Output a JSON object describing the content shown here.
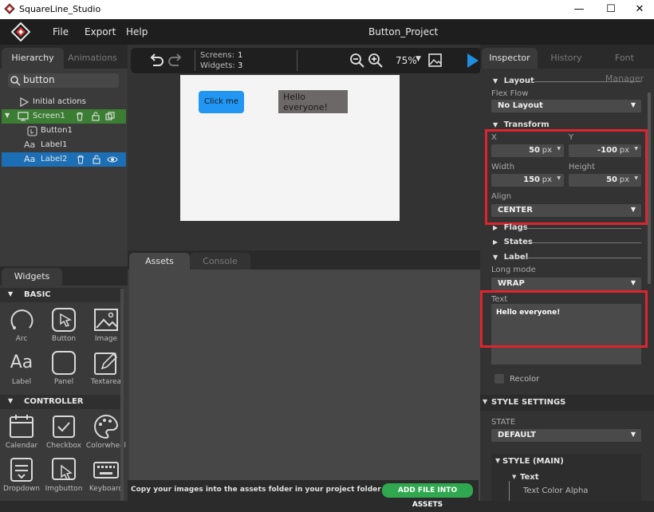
{
  "window": {
    "title": "SquareLine_Studio"
  },
  "menu": {
    "items": [
      "File",
      "Export",
      "Help"
    ],
    "project": "Button_Project"
  },
  "hierarchy": {
    "tabs": [
      "Hierarchy",
      "Animations"
    ],
    "search": "button",
    "tree": [
      {
        "label": "Initial actions"
      },
      {
        "label": "Screen1"
      },
      {
        "label": "Button1"
      },
      {
        "label": "Label1"
      },
      {
        "label": "Label2"
      }
    ]
  },
  "widgets": {
    "tab": "Widgets",
    "basic": {
      "title": "BASIC",
      "items": [
        "Arc",
        "Button",
        "Image",
        "Label",
        "Panel",
        "Textarea"
      ]
    },
    "controller": {
      "title": "CONTROLLER",
      "items": [
        "Calendar",
        "Checkbox",
        "Colorwheel",
        "Dropdown",
        "Imgbutton",
        "Keyboard"
      ]
    }
  },
  "toolbar": {
    "screens_label": "Screens:",
    "screens_value": "1",
    "widgets_label": "Widgets:",
    "widgets_value": "3",
    "zoom": "75%"
  },
  "canvas": {
    "button_text": "Click me",
    "label_text": "Hello everyone!"
  },
  "assets": {
    "tabs": [
      "Assets",
      "Console"
    ],
    "footer_text": "Copy your images into the assets folder in your project folder",
    "add_button": "ADD FILE INTO ASSETS"
  },
  "inspector": {
    "tabs": [
      "Inspector",
      "History",
      "Font Manager"
    ],
    "layout": {
      "title": "Layout",
      "flex_label": "Flex Flow",
      "flex_value": "No Layout"
    },
    "transform": {
      "title": "Transform",
      "x_label": "X",
      "x_value": "50",
      "x_unit": "px",
      "y_label": "Y",
      "y_value": "-100",
      "y_unit": "px",
      "w_label": "Width",
      "w_value": "150",
      "w_unit": "px",
      "h_label": "Height",
      "h_value": "50",
      "h_unit": "px",
      "align_label": "Align",
      "align_value": "CENTER"
    },
    "flags": "Flags",
    "states": "States",
    "label": {
      "title": "Label",
      "long_mode_label": "Long mode",
      "long_mode_value": "WRAP",
      "text_label": "Text",
      "text_value": "Hello everyone!",
      "recolor": "Recolor"
    },
    "style_settings": "STYLE SETTINGS",
    "state_label": "STATE",
    "state_value": "DEFAULT",
    "style_main": "STYLE (MAIN)",
    "text_section": "Text",
    "text_color_label": "Text Color",
    "alpha_label": "Alpha"
  }
}
